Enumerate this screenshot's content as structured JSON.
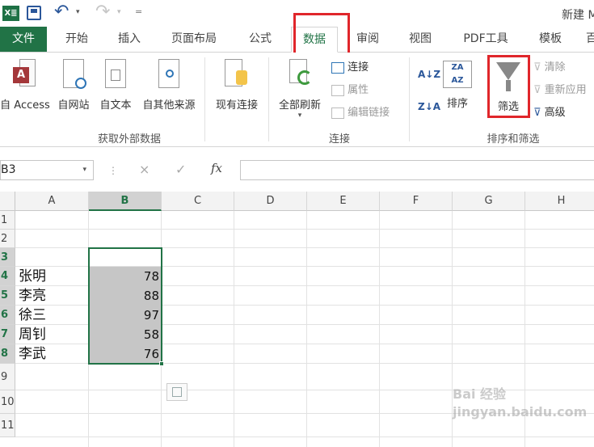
{
  "title": "新建 M",
  "tabs": [
    "文件",
    "开始",
    "插入",
    "页面布局",
    "公式",
    "数据",
    "审阅",
    "视图",
    "PDF工具",
    "模板",
    "百"
  ],
  "ribbon": {
    "get_external": {
      "access": "自 Access",
      "web": "自网站",
      "text": "自文本",
      "other": "自其他来源",
      "existing": "现有连接",
      "group": "获取外部数据"
    },
    "connections": {
      "refresh_all": "全部刷新",
      "connect": "连接",
      "properties": "属性",
      "edit_links": "编辑链接",
      "group": "连接"
    },
    "sort_filter": {
      "az": "A↓Z",
      "za": "Z↓A",
      "sort": "排序",
      "filter": "筛选",
      "clear": "清除",
      "reapply": "重新应用",
      "advanced": "高级",
      "group": "排序和筛选"
    }
  },
  "formula_bar": {
    "name_box": "B3",
    "cancel": "×",
    "enter": "✓",
    "fx": "fx",
    "value": ""
  },
  "grid": {
    "columns": [
      "A",
      "B",
      "C",
      "D",
      "E",
      "F",
      "G",
      "H"
    ],
    "rows": [
      "1",
      "2",
      "3",
      "4",
      "5",
      "6",
      "7",
      "8",
      "9",
      "10",
      "11"
    ],
    "names": [
      "张明",
      "李亮",
      "徐三",
      "周钊",
      "李武"
    ],
    "scores": [
      "78",
      "88",
      "97",
      "58",
      "76"
    ]
  },
  "watermark": "Bai 经验 jingyan.baidu.com",
  "colors": {
    "excel_green": "#217346",
    "highlight_red": "#e0262b"
  }
}
